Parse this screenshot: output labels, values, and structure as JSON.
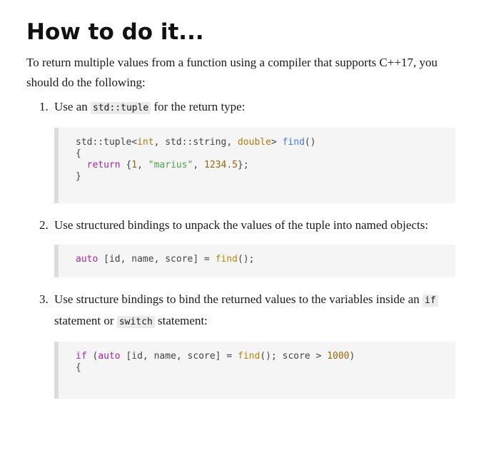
{
  "title": "How to do it...",
  "intro": "To return multiple values from a function using a compiler that supports C++17, you should do the following:",
  "steps": [
    {
      "number": "1.",
      "text_before": "Use an ",
      "code": "std::tuple",
      "text_after": " for the return type:",
      "codeblock": {
        "line1": {
          "a": "std::tuple<",
          "b": "int",
          "c": ", std::string, ",
          "d": "double",
          "e": "> ",
          "f": "find",
          "g": "()"
        },
        "line2": "{",
        "line3": {
          "kw": "return",
          "a": " {",
          "n1": "1",
          "b": ", ",
          "s": "\"marius\"",
          "c": ", ",
          "n2": "1234.5",
          "d": "};"
        },
        "line4": "}"
      }
    },
    {
      "number": "2.",
      "text": "Use structured bindings to unpack the values of the tuple into named objects:",
      "codeblock": {
        "line1": {
          "kw": "auto",
          "a": " [id, name, score] = ",
          "fn": "find",
          "b": "();"
        }
      }
    },
    {
      "number": "3.",
      "text_before": "Use structure bindings to bind the returned values to the variables inside an ",
      "code1": "if",
      "text_mid": " statement or ",
      "code2": "switch",
      "text_after": " statement:",
      "codeblock": {
        "line1": {
          "kw1": "if",
          "a": " (",
          "kw2": "auto",
          "b": " [id, name, score] = ",
          "fn": "find",
          "c": "(); score > ",
          "num": "1000",
          "d": ")"
        },
        "line2": "{"
      }
    }
  ]
}
